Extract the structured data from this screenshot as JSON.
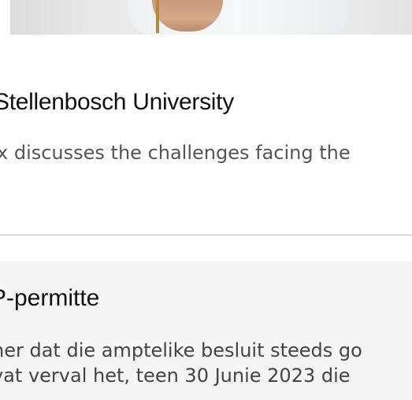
{
  "article_1": {
    "title": "Stellenbosch University",
    "description": "x discusses the challenges facing the"
  },
  "article_2": {
    "title": "P-permitte",
    "body_lines": [
      "ner dat die amptelike besluit steeds go",
      "vat verval het, teen 30 Junie 2023 die"
    ]
  }
}
